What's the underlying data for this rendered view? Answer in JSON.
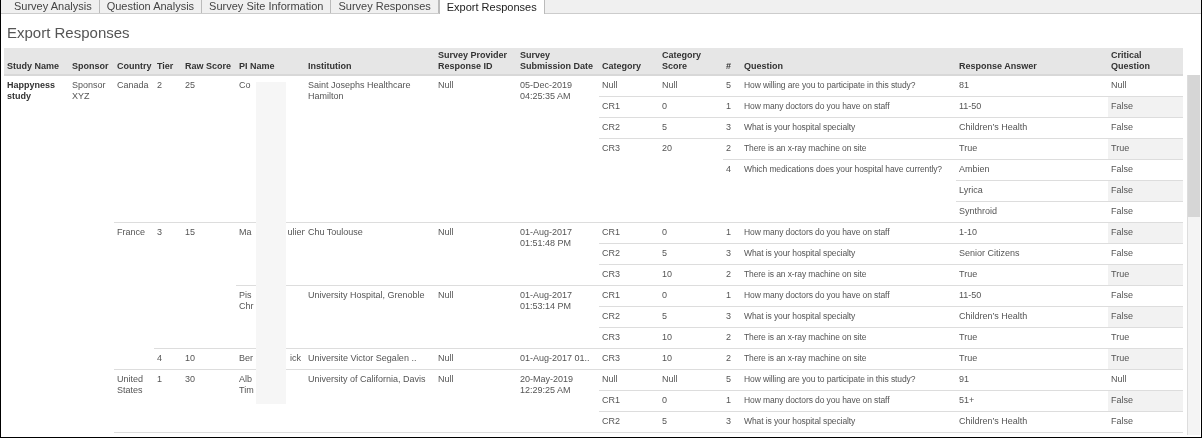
{
  "tabs": [
    {
      "label": "Survey Analysis",
      "selected": false
    },
    {
      "label": "Question Analysis",
      "selected": false
    },
    {
      "label": "Survey Site Information",
      "selected": false
    },
    {
      "label": "Survey Responses",
      "selected": false
    },
    {
      "label": "Export Responses",
      "selected": true
    }
  ],
  "title": "Export Responses",
  "table": {
    "columns": [
      "Study Name",
      "Sponsor",
      "Country",
      "Tier",
      "Raw Score",
      "PI Name",
      "Institution",
      "Survey Provider Response ID",
      "Survey Submission Date",
      "Category",
      "Category Score",
      "#",
      "Question",
      "Response Answer",
      "Critical Question"
    ],
    "studies": [
      {
        "name": "Happyness study",
        "sponsor": "Sponsor XYZ",
        "countries": [
          {
            "name": "Canada",
            "tiers": [
              {
                "tier": "2",
                "raw_score": "25",
                "sites": [
                  {
                    "pi_lines": [
                      {
                        "start": "Co"
                      }
                    ],
                    "institution": "Saint Josephs Healthcare Hamilton",
                    "response_id": "Null",
                    "date": "05-Dec-2019 04:25:35 AM",
                    "categories": [
                      {
                        "name": "Null",
                        "score": "Null",
                        "questions": [
                          {
                            "num": "5",
                            "text": "How willing are you to participate in this study?",
                            "answers": [
                              {
                                "answer": "81",
                                "critical": "Null"
                              }
                            ]
                          }
                        ]
                      },
                      {
                        "name": "CR1",
                        "score": "0",
                        "questions": [
                          {
                            "num": "1",
                            "text": "How many doctors do you have on staff",
                            "answers": [
                              {
                                "answer": "11-50",
                                "critical": "False"
                              }
                            ]
                          }
                        ]
                      },
                      {
                        "name": "CR2",
                        "score": "5",
                        "questions": [
                          {
                            "num": "3",
                            "text": "What is your hospital specialty",
                            "answers": [
                              {
                                "answer": "Children’s Health",
                                "critical": "False"
                              }
                            ]
                          }
                        ]
                      },
                      {
                        "name": "CR3",
                        "score": "20",
                        "questions": [
                          {
                            "num": "2",
                            "text": "There is an x-ray machine on site",
                            "answers": [
                              {
                                "answer": "True",
                                "critical": "True"
                              }
                            ]
                          },
                          {
                            "num": "4",
                            "text": "Which medications does your hospital have currently?",
                            "answers": [
                              {
                                "answer": "Ambien",
                                "critical": "False"
                              },
                              {
                                "answer": "Lyrica",
                                "critical": "False"
                              },
                              {
                                "answer": "Synthroid",
                                "critical": "False"
                              }
                            ]
                          }
                        ]
                      }
                    ]
                  }
                ]
              }
            ]
          },
          {
            "name": "France",
            "tiers": [
              {
                "tier": "3",
                "raw_score": "15",
                "sites": [
                  {
                    "pi_lines": [
                      {
                        "start": "Ma",
                        "end": "ulien"
                      }
                    ],
                    "institution": "Chu Toulouse",
                    "response_id": "Null",
                    "date": "01-Aug-2017 01:51:48 PM",
                    "categories": [
                      {
                        "name": "CR1",
                        "score": "0",
                        "questions": [
                          {
                            "num": "1",
                            "text": "How many doctors do you have on staff",
                            "answers": [
                              {
                                "answer": "1-10",
                                "critical": "False"
                              }
                            ]
                          }
                        ]
                      },
                      {
                        "name": "CR2",
                        "score": "5",
                        "questions": [
                          {
                            "num": "3",
                            "text": "What is your hospital specialty",
                            "answers": [
                              {
                                "answer": "Senior Citizens",
                                "critical": "False"
                              }
                            ]
                          }
                        ]
                      },
                      {
                        "name": "CR3",
                        "score": "10",
                        "questions": [
                          {
                            "num": "2",
                            "text": "There is an x-ray machine on site",
                            "answers": [
                              {
                                "answer": "True",
                                "critical": "True"
                              }
                            ]
                          }
                        ]
                      }
                    ]
                  },
                  {
                    "pi_lines": [
                      {
                        "start": "Pis"
                      },
                      {
                        "start": "Chr"
                      }
                    ],
                    "institution": "University Hospital, Grenoble",
                    "response_id": "Null",
                    "date": "01-Aug-2017 01:53:14 PM",
                    "categories": [
                      {
                        "name": "CR1",
                        "score": "0",
                        "questions": [
                          {
                            "num": "1",
                            "text": "How many doctors do you have on staff",
                            "answers": [
                              {
                                "answer": "11-50",
                                "critical": "False"
                              }
                            ]
                          }
                        ]
                      },
                      {
                        "name": "CR2",
                        "score": "5",
                        "questions": [
                          {
                            "num": "3",
                            "text": "What is your hospital specialty",
                            "answers": [
                              {
                                "answer": "Children’s Health",
                                "critical": "False"
                              }
                            ]
                          }
                        ]
                      },
                      {
                        "name": "CR3",
                        "score": "10",
                        "questions": [
                          {
                            "num": "2",
                            "text": "There is an x-ray machine on site",
                            "answers": [
                              {
                                "answer": "True",
                                "critical": "True"
                              }
                            ]
                          }
                        ]
                      }
                    ]
                  }
                ]
              },
              {
                "tier": "4",
                "raw_score": "10",
                "sites": [
                  {
                    "pi_lines": [
                      {
                        "start": "Ber",
                        "end": "ick"
                      }
                    ],
                    "institution": "Universite Victor Segalen ..",
                    "response_id": "Null",
                    "date": "01-Aug-2017 01..",
                    "categories": [
                      {
                        "name": "CR3",
                        "score": "10",
                        "questions": [
                          {
                            "num": "2",
                            "text": "There is an x-ray machine on site",
                            "answers": [
                              {
                                "answer": "True",
                                "critical": "True"
                              }
                            ]
                          }
                        ]
                      }
                    ]
                  }
                ]
              }
            ]
          },
          {
            "name": "United States",
            "tiers": [
              {
                "tier": "1",
                "raw_score": "30",
                "sites": [
                  {
                    "pi_lines": [
                      {
                        "start": "Alb"
                      },
                      {
                        "start": "Tim"
                      }
                    ],
                    "institution": "University of California, Davis",
                    "response_id": "Null",
                    "date": "20-May-2019 12:29:25 AM",
                    "categories": [
                      {
                        "name": "Null",
                        "score": "Null",
                        "questions": [
                          {
                            "num": "5",
                            "text": "How willing are you to participate in this study?",
                            "answers": [
                              {
                                "answer": "91",
                                "critical": "Null"
                              }
                            ]
                          }
                        ]
                      },
                      {
                        "name": "CR1",
                        "score": "0",
                        "questions": [
                          {
                            "num": "1",
                            "text": "How many doctors do you have on staff",
                            "answers": [
                              {
                                "answer": "51+",
                                "critical": "False"
                              }
                            ]
                          }
                        ]
                      },
                      {
                        "name": "CR2",
                        "score": "5",
                        "questions": [
                          {
                            "num": "3",
                            "text": "What is your hospital specialty",
                            "answers": [
                              {
                                "answer": "Children’s Health",
                                "critical": "False"
                              }
                            ]
                          }
                        ]
                      }
                    ]
                  }
                ]
              }
            ]
          }
        ]
      }
    ]
  }
}
